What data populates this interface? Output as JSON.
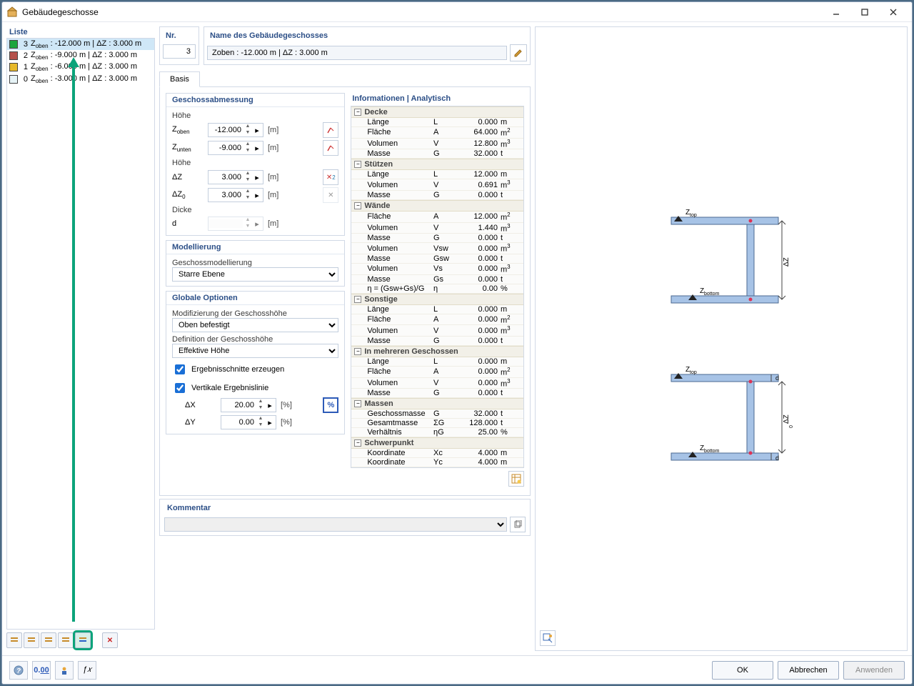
{
  "title": "Gebäudegeschosse",
  "list": {
    "header": "Liste",
    "items": [
      {
        "color": "#1aa53e",
        "num": "3",
        "text": "Zoben : -12.000 m | ΔZ : 3.000 m",
        "sel": true
      },
      {
        "color": "#b5514a",
        "num": "2",
        "text": "Zoben : -9.000 m | ΔZ : 3.000 m",
        "sel": false
      },
      {
        "color": "#e7b92a",
        "num": "1",
        "text": "Zoben : -6.000 m | ΔZ : 3.000 m",
        "sel": false
      },
      {
        "color": "#e6f3f6",
        "num": "0",
        "text": "Zoben : -3.000 m | ΔZ : 3.000 m",
        "sel": false
      }
    ]
  },
  "nr": {
    "label": "Nr.",
    "value": "3"
  },
  "name": {
    "label": "Name des Gebäudegeschosses",
    "value": "Zoben : -12.000 m | ΔZ : 3.000 m"
  },
  "tab": "Basis",
  "dims": {
    "title": "Geschossabmessung",
    "hohe1": "Höhe",
    "zoben": {
      "sym": "Zoben",
      "val": "-12.000",
      "unit": "[m]"
    },
    "zunten": {
      "sym": "Zunten",
      "val": "-9.000",
      "unit": "[m]"
    },
    "hohe2": "Höhe",
    "dz": {
      "sym": "ΔZ",
      "val": "3.000",
      "unit": "[m]"
    },
    "dz0": {
      "sym": "ΔZ0",
      "val": "3.000",
      "unit": "[m]"
    },
    "dicke": "Dicke",
    "d": {
      "sym": "d",
      "val": "",
      "unit": "[m]"
    }
  },
  "model": {
    "title": "Modellierung",
    "lbl": "Geschossmodellierung",
    "sel": "Starre Ebene"
  },
  "global": {
    "title": "Globale Optionen",
    "lbl1": "Modifizierung der Geschosshöhe",
    "sel1": "Oben befestigt",
    "lbl2": "Definition der Geschosshöhe",
    "sel2": "Effektive Höhe",
    "chk1": "Ergebnisschnitte erzeugen",
    "chk2": "Vertikale Ergebnislinie",
    "dx": {
      "sym": "ΔX",
      "val": "20.00",
      "unit": "[%]"
    },
    "dy": {
      "sym": "ΔY",
      "val": "0.00",
      "unit": "[%]"
    }
  },
  "info": {
    "title": "Informationen | Analytisch",
    "groups": [
      {
        "name": "Decke",
        "rows": [
          {
            "a": "Länge",
            "b": "L",
            "c": "0.000",
            "d": "m"
          },
          {
            "a": "Fläche",
            "b": "A",
            "c": "64.000",
            "d": "m²"
          },
          {
            "a": "Volumen",
            "b": "V",
            "c": "12.800",
            "d": "m³"
          },
          {
            "a": "Masse",
            "b": "G",
            "c": "32.000",
            "d": "t"
          }
        ]
      },
      {
        "name": "Stützen",
        "rows": [
          {
            "a": "Länge",
            "b": "L",
            "c": "12.000",
            "d": "m"
          },
          {
            "a": "Volumen",
            "b": "V",
            "c": "0.691",
            "d": "m³"
          },
          {
            "a": "Masse",
            "b": "G",
            "c": "0.000",
            "d": "t"
          }
        ]
      },
      {
        "name": "Wände",
        "rows": [
          {
            "a": "Fläche",
            "b": "A",
            "c": "12.000",
            "d": "m²"
          },
          {
            "a": "Volumen",
            "b": "V",
            "c": "1.440",
            "d": "m³"
          },
          {
            "a": "Masse",
            "b": "G",
            "c": "0.000",
            "d": "t"
          },
          {
            "a": "Volumen",
            "b": "Vsw",
            "c": "0.000",
            "d": "m³"
          },
          {
            "a": "Masse",
            "b": "Gsw",
            "c": "0.000",
            "d": "t"
          },
          {
            "a": "Volumen",
            "b": "Vs",
            "c": "0.000",
            "d": "m³"
          },
          {
            "a": "Masse",
            "b": "Gs",
            "c": "0.000",
            "d": "t"
          },
          {
            "a": "η = (Gsw+Gs)/G",
            "b": "η",
            "c": "0.00",
            "d": "%"
          }
        ]
      },
      {
        "name": "Sonstige",
        "rows": [
          {
            "a": "Länge",
            "b": "L",
            "c": "0.000",
            "d": "m"
          },
          {
            "a": "Fläche",
            "b": "A",
            "c": "0.000",
            "d": "m²"
          },
          {
            "a": "Volumen",
            "b": "V",
            "c": "0.000",
            "d": "m³"
          },
          {
            "a": "Masse",
            "b": "G",
            "c": "0.000",
            "d": "t"
          }
        ]
      },
      {
        "name": "In mehreren Geschossen",
        "rows": [
          {
            "a": "Länge",
            "b": "L",
            "c": "0.000",
            "d": "m"
          },
          {
            "a": "Fläche",
            "b": "A",
            "c": "0.000",
            "d": "m²"
          },
          {
            "a": "Volumen",
            "b": "V",
            "c": "0.000",
            "d": "m³"
          },
          {
            "a": "Masse",
            "b": "G",
            "c": "0.000",
            "d": "t"
          }
        ]
      },
      {
        "name": "Massen",
        "rows": [
          {
            "a": "Geschossmasse",
            "b": "G",
            "c": "32.000",
            "d": "t"
          },
          {
            "a": "Gesamtmasse",
            "b": "ΣG",
            "c": "128.000",
            "d": "t"
          },
          {
            "a": "Verhältnis",
            "b": "ηG",
            "c": "25.00",
            "d": "%"
          }
        ]
      },
      {
        "name": "Schwerpunkt",
        "rows": [
          {
            "a": "Koordinate",
            "b": "Xc",
            "c": "4.000",
            "d": "m"
          },
          {
            "a": "Koordinate",
            "b": "Yc",
            "c": "4.000",
            "d": "m"
          }
        ]
      }
    ]
  },
  "comment": {
    "title": "Kommentar",
    "value": ""
  },
  "footer": {
    "ok": "OK",
    "cancel": "Abbrechen",
    "apply": "Anwenden"
  },
  "diagram": {
    "ztop": "Ztop",
    "zbot": "Zbottom",
    "dz": "ΔZ",
    "dz0": "ΔZ0",
    "d": "d"
  }
}
